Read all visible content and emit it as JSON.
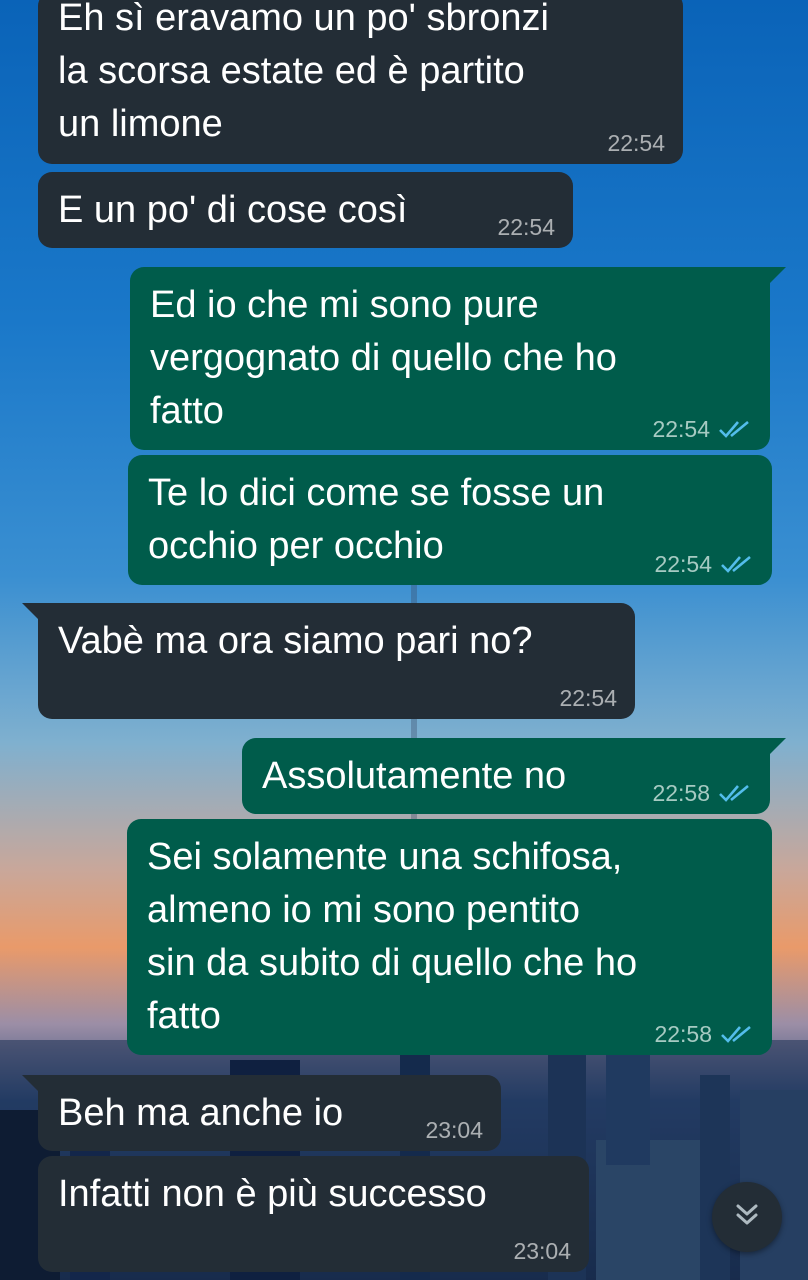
{
  "messages": [
    {
      "direction": "incoming",
      "text": "Eh sì eravamo un po' sbronzi\nla scorsa estate ed è partito\nun limone",
      "time": "22:54"
    },
    {
      "direction": "incoming",
      "text": "E un po' di cose così",
      "time": "22:54"
    },
    {
      "direction": "outgoing",
      "text": "Ed io che mi sono pure\nvergognato di quello che ho\nfatto",
      "time": "22:54",
      "status": "read"
    },
    {
      "direction": "outgoing",
      "text": "Te lo dici come se fosse un\nocchio per occhio",
      "time": "22:54",
      "status": "read"
    },
    {
      "direction": "incoming",
      "text": "Vabè ma ora siamo pari no?",
      "time": "22:54"
    },
    {
      "direction": "outgoing",
      "text": "Assolutamente no",
      "time": "22:58",
      "status": "read"
    },
    {
      "direction": "outgoing",
      "text": "Sei solamente una schifosa,\nalmeno io mi sono pentito\nsin da subito di quello che ho\nfatto",
      "time": "22:58",
      "status": "read"
    },
    {
      "direction": "incoming",
      "text": "Beh ma anche io",
      "time": "23:04"
    },
    {
      "direction": "incoming",
      "text": "Infatti non è più successo",
      "time": "23:04"
    }
  ],
  "colors": {
    "incoming_bubble": "#232d36",
    "outgoing_bubble": "#005c4b",
    "read_ticks": "#53bdeb"
  },
  "icons": {
    "read_receipt": "double-check-icon",
    "scroll_down": "double-chevron-down-icon"
  }
}
